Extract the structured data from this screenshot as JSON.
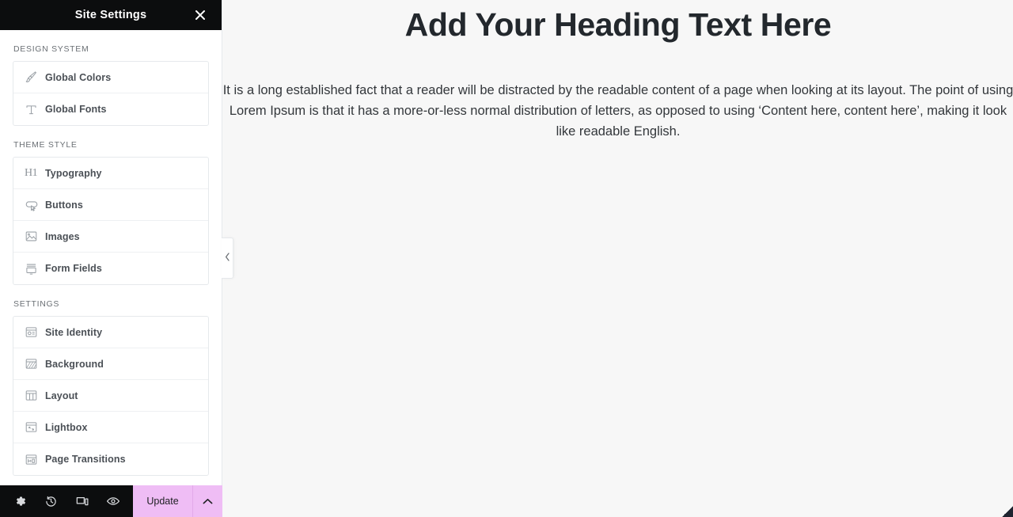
{
  "panel": {
    "header": {
      "title": "Site Settings",
      "close_icon": "close-icon"
    },
    "sections": [
      {
        "label": "DESIGN SYSTEM",
        "items": [
          {
            "label": "Global Colors",
            "icon": "paintbrush-icon"
          },
          {
            "label": "Global Fonts",
            "icon": "text-t-icon"
          }
        ]
      },
      {
        "label": "THEME STYLE",
        "items": [
          {
            "label": "Typography",
            "icon": "heading-h1-icon"
          },
          {
            "label": "Buttons",
            "icon": "button-cursor-icon"
          },
          {
            "label": "Images",
            "icon": "image-icon"
          },
          {
            "label": "Form Fields",
            "icon": "form-fields-icon"
          }
        ]
      },
      {
        "label": "SETTINGS",
        "items": [
          {
            "label": "Site Identity",
            "icon": "site-identity-icon"
          },
          {
            "label": "Background",
            "icon": "background-icon"
          },
          {
            "label": "Layout",
            "icon": "layout-icon"
          },
          {
            "label": "Lightbox",
            "icon": "lightbox-icon"
          },
          {
            "label": "Page Transitions",
            "icon": "page-transitions-icon"
          }
        ]
      }
    ],
    "collapse_handle_icon": "chevron-left-icon"
  },
  "footer": {
    "tools": [
      {
        "name": "settings-gear",
        "icon": "gear-icon"
      },
      {
        "name": "history",
        "icon": "history-clock-icon"
      },
      {
        "name": "responsive-mode",
        "icon": "responsive-devices-icon"
      },
      {
        "name": "preview-changes",
        "icon": "eye-icon"
      }
    ],
    "update_label": "Update",
    "caret_icon": "chevron-up-icon",
    "update_button_color": "#efbdf5"
  },
  "canvas": {
    "heading": "Add Your Heading Text Here",
    "paragraph": "It is a long established fact that a reader will be distracted by the readable content of a page when looking at its layout. The point of using Lorem Ipsum is that it has a more-or-less normal distribution of letters, as opposed to using ‘Content here, content here’, making it look like readable English.",
    "background_color": "#f7f7f7",
    "heading_color": "#23282d"
  }
}
